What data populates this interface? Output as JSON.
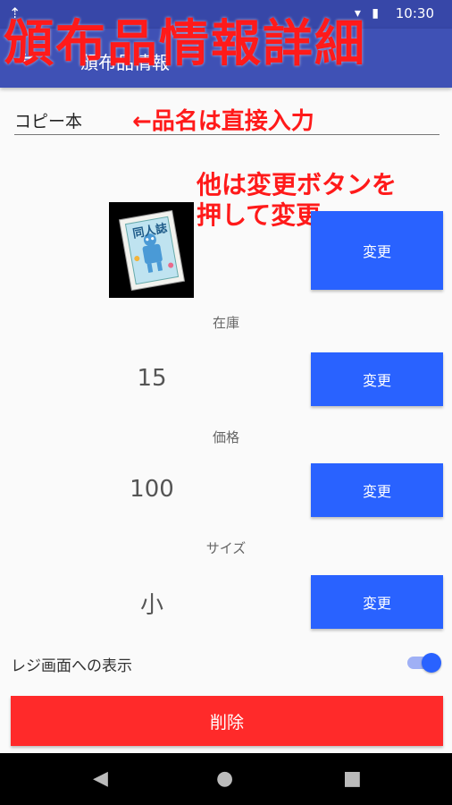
{
  "status_bar": {
    "time": "10:30",
    "icons": "▾ ▮"
  },
  "app_bar": {
    "back_icon": "arrow-back-icon",
    "title": "頒布品情報"
  },
  "overlay_title": "頒布品情報詳細",
  "item": {
    "name_value": "コピー本",
    "name_note": "←品名は直接入力",
    "other_note_line1": "他は変更ボタンを",
    "other_note_line2": "押して変更",
    "thumbnail_text": "同人誌"
  },
  "fields": {
    "stock": {
      "label": "在庫",
      "value": "15"
    },
    "price": {
      "label": "価格",
      "value": "100"
    },
    "size": {
      "label": "サイズ",
      "value": "小"
    }
  },
  "buttons": {
    "change_label": "変更",
    "delete_label": "削除"
  },
  "register_display": {
    "label": "レジ画面への表示",
    "on": true
  },
  "nav": {
    "back": "◀",
    "home": "●",
    "recent": "■"
  },
  "colors": {
    "primary": "#3f51b5",
    "accent": "#2962ff",
    "delete": "#ff2a2a",
    "annotation": "#ff1a1a"
  }
}
